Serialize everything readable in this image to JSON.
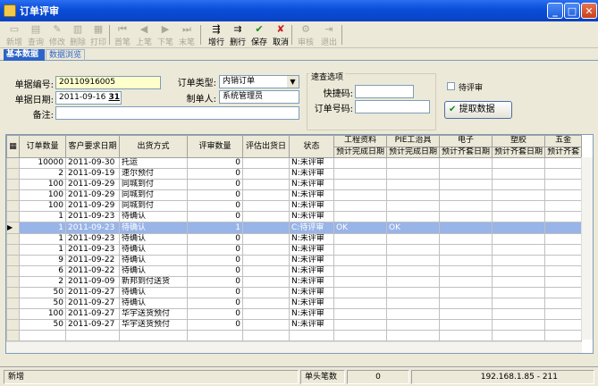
{
  "window": {
    "title": "订单评审",
    "min": "_",
    "max": "□",
    "close": "✕"
  },
  "toolbar": {
    "buttons": [
      {
        "label": "新增",
        "icon": "new-doc-icon",
        "glyph": "▭"
      },
      {
        "label": "查询",
        "icon": "query-icon",
        "glyph": "▤"
      },
      {
        "label": "修改",
        "icon": "edit-icon",
        "glyph": "✎"
      },
      {
        "label": "删除",
        "icon": "delete-icon",
        "glyph": "▥"
      },
      {
        "label": "打印",
        "icon": "print-icon",
        "glyph": "▦"
      },
      {
        "label": "首笔",
        "icon": "first-record-icon",
        "glyph": "⏮"
      },
      {
        "label": "上笔",
        "icon": "prev-record-icon",
        "glyph": "◀"
      },
      {
        "label": "下笔",
        "icon": "next-record-icon",
        "glyph": "▶"
      },
      {
        "label": "末笔",
        "icon": "last-record-icon",
        "glyph": "⏭"
      },
      {
        "label": "增行",
        "icon": "add-row-icon",
        "glyph": "⇶"
      },
      {
        "label": "删行",
        "icon": "delete-row-icon",
        "glyph": "⇉"
      },
      {
        "label": "保存",
        "icon": "save-check-icon",
        "glyph": "✔"
      },
      {
        "label": "取消",
        "icon": "cancel-x-icon",
        "glyph": "✘"
      },
      {
        "label": "审核",
        "icon": "audit-icon",
        "glyph": "⚙"
      },
      {
        "label": "退出",
        "icon": "exit-icon",
        "glyph": "⇥"
      }
    ]
  },
  "tabs": {
    "basic": "基本数据",
    "browse": "数据浏览"
  },
  "form": {
    "doc_no_label": "单据编号:",
    "doc_no": "20110916005",
    "doc_date_label": "单据日期:",
    "doc_date": "2011-09-16",
    "date_btn": "31",
    "remark_label": "备注:",
    "order_type_label": "订单类型:",
    "order_type": "内销订单",
    "maker_label": "制单人:",
    "maker": "系统管理员",
    "quick_title": "速查选项",
    "quick_code_label": "快捷码:",
    "order_no_label": "订单号码:",
    "pending_label": "待评审",
    "fetch_label": "提取数据"
  },
  "grid": {
    "headers": [
      "订单数量",
      "客户要求日期",
      "出货方式",
      "评审数量",
      "评估出货日",
      "状态"
    ],
    "group_headers": [
      {
        "top": "工程资料",
        "sub": "预计完成日期"
      },
      {
        "top": "PIE工治具",
        "sub": "预计完成日期"
      },
      {
        "top": "电子",
        "sub": "预计齐套日期"
      },
      {
        "top": "塑胶",
        "sub": "预计齐套日期"
      },
      {
        "top": "五金",
        "sub": "预计齐套"
      }
    ],
    "rows": [
      [
        "10000",
        "2011-09-30",
        "托运",
        "0",
        "",
        "N:未评审",
        "",
        ""
      ],
      [
        "2",
        "2011-09-19",
        "速尔预付",
        "0",
        "",
        "N:未评审",
        "",
        ""
      ],
      [
        "100",
        "2011-09-29",
        "同城到付",
        "0",
        "",
        "N:未评审",
        "",
        ""
      ],
      [
        "100",
        "2011-09-29",
        "同城到付",
        "0",
        "",
        "N:未评审",
        "",
        ""
      ],
      [
        "100",
        "2011-09-29",
        "同城到付",
        "0",
        "",
        "N:未评审",
        "",
        ""
      ],
      [
        "1",
        "2011-09-23",
        "待确认",
        "0",
        "",
        "N:未评审",
        "",
        ""
      ],
      [
        "1",
        "2011-09-23",
        "待确认",
        "1",
        "",
        "C:待评审",
        "OK",
        "OK"
      ],
      [
        "1",
        "2011-09-23",
        "待确认",
        "0",
        "",
        "N:未评审",
        "",
        ""
      ],
      [
        "1",
        "2011-09-23",
        "待确认",
        "0",
        "",
        "N:未评审",
        "",
        ""
      ],
      [
        "9",
        "2011-09-22",
        "待确认",
        "0",
        "",
        "N:未评审",
        "",
        ""
      ],
      [
        "6",
        "2011-09-22",
        "待确认",
        "0",
        "",
        "N:未评审",
        "",
        ""
      ],
      [
        "2",
        "2011-09-09",
        "新邦到付送货",
        "0",
        "",
        "N:未评审",
        "",
        ""
      ],
      [
        "50",
        "2011-09-27",
        "待确认",
        "0",
        "",
        "N:未评审",
        "",
        ""
      ],
      [
        "50",
        "2011-09-27",
        "待确认",
        "0",
        "",
        "N:未评审",
        "",
        ""
      ],
      [
        "100",
        "2011-09-27",
        "华宇送货预付",
        "0",
        "",
        "N:未评审",
        "",
        ""
      ],
      [
        "50",
        "2011-09-27",
        "华宇送货预付",
        "0",
        "",
        "N:未评审",
        "",
        ""
      ]
    ],
    "selected_row": 6
  },
  "status": {
    "mode": "新增",
    "count_label": "单头笔数",
    "count": "0",
    "ip": "192.168.1.85 - 211"
  }
}
